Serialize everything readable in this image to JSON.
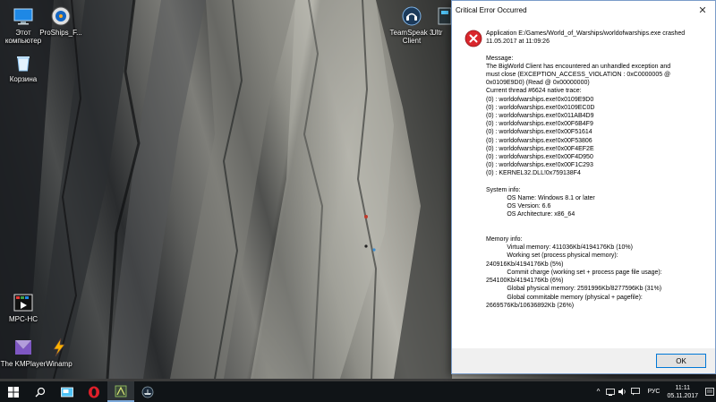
{
  "desktop": {
    "icons": [
      {
        "label": "Этот компьютер"
      },
      {
        "label": "ProShips_F..."
      },
      {
        "label": "Корзина"
      },
      {
        "label": "TeamSpeak 3 Client"
      },
      {
        "label": "Ultr"
      },
      {
        "label": "MPC-HC"
      },
      {
        "label": "The KMPlayer"
      },
      {
        "label": "Winamp"
      }
    ]
  },
  "dialog": {
    "title": "Critical Error Occurred",
    "icon": "error-icon",
    "message_text": "Application E:/Games/World_of_Warships/worldofwarships.exe crashed\n11.05.2017 at 11:09:26\n\nMessage:\nThe BigWorld Client has encountered an unhandled exception and\nmust close (EXCEPTION_ACCESS_VIOLATION : 0xC0000005 @\n0x0109E9D0) (Read @ 0x00000000)\nCurrent thread #6624 native trace:\n(0) : worldofwarships.exe!0x0109E9D0\n(0) : worldofwarships.exe!0x0109EC0D\n(0) : worldofwarships.exe!0x011AB4D9\n(0) : worldofwarships.exe!0x00F6B4F9\n(0) : worldofwarships.exe!0x00F51614\n(0) : worldofwarships.exe!0x00F53806\n(0) : worldofwarships.exe!0x00F4EF2E\n(0) : worldofwarships.exe!0x00F4D950\n(0) : worldofwarships.exe!0x00F1C293\n(0) : KERNEL32.DLL!0x759138F4\n\nSystem info:\n            OS Name: Windows 8.1 or later\n            OS Version: 6.6\n            OS Architecture: x86_64\n\n\nMemory info:\n            Virtual memory: 411036Kb/4194176Kb (10%)\n            Working set (process physical memory):\n240916Kb/4194176Kb (5%)\n            Commit charge (working set + process page file usage):\n254100Kb/4194176Kb (6%)\n            Global physical memory: 2591996Kb/8277596Kb (31%)\n            Global commitable memory (physical + pagefile):\n2669576Kb/10636892Kb (26%)\n\n\n\n\n\nThe application must exit.",
    "ok_label": "OK",
    "close_glyph": "✕"
  },
  "taskbar": {
    "items": [
      "windows-logo-icon",
      "search-icon",
      "task-view-icon",
      "opera-icon",
      "game-center-icon",
      "world-of-warships-icon"
    ],
    "tray": {
      "language": "РУС",
      "time": "11:11",
      "date": "05.11.2017"
    }
  },
  "colors": {
    "accent": "#0078d7",
    "error_red": "#d9262c",
    "taskbar_bg": "#101417"
  }
}
